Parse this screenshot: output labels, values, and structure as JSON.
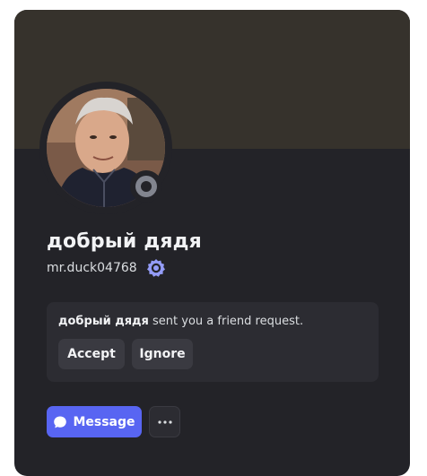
{
  "profile": {
    "display_name": "добрый дядя",
    "username": "mr.duck04768",
    "status": "offline",
    "badge_icon": "nitro-badge-icon",
    "colors": {
      "banner": "#36322c",
      "card": "#232328",
      "status": "#82858f",
      "badge": "#949cf7"
    }
  },
  "friend_request": {
    "sender": "добрый дядя",
    "message": " sent you a friend request.",
    "accept_label": "Accept",
    "ignore_label": "Ignore"
  },
  "actions": {
    "message_label": "Message",
    "message_icon": "chat-bubble-icon",
    "more_icon": "ellipsis-icon",
    "accent": "#5865f2"
  }
}
